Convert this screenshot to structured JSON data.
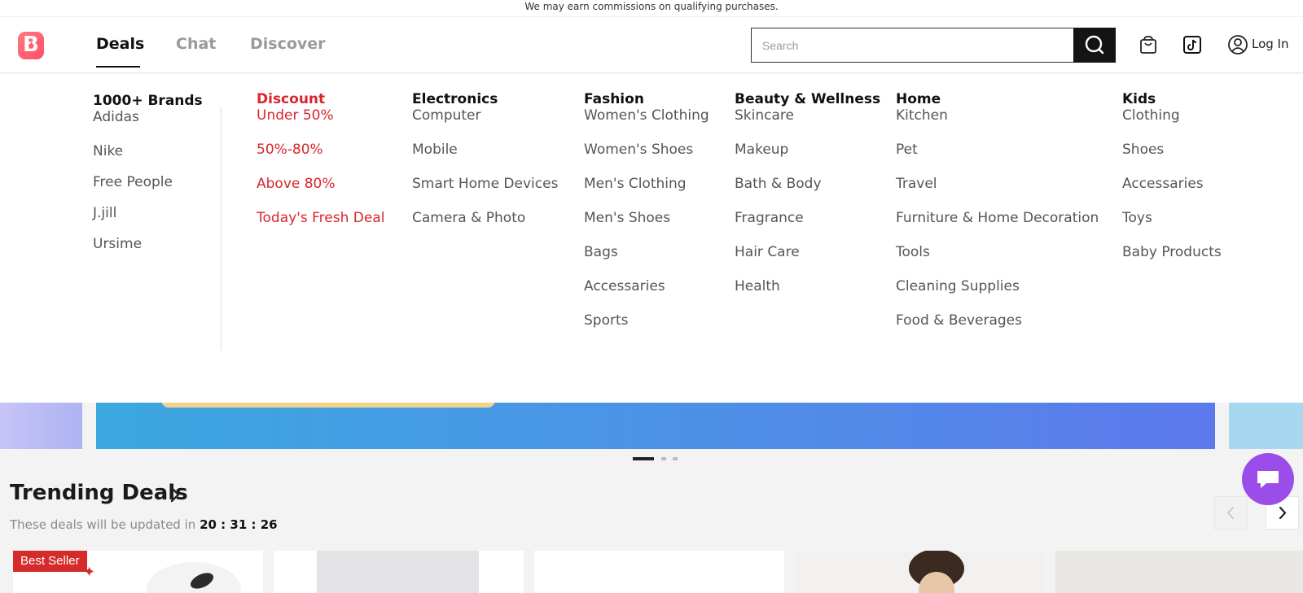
{
  "disclaimer": "We may earn commissions on qualifying purchases.",
  "nav": {
    "tabs": [
      "Deals",
      "Chat",
      "Discover"
    ],
    "active_tab": "Deals"
  },
  "search": {
    "placeholder": "Search"
  },
  "header_actions": {
    "cart_icon": "shopping-bag-icon",
    "tiktok_icon": "tiktok-icon",
    "user_icon": "user-circle-icon",
    "login_label": "Log In"
  },
  "menu": {
    "brands": {
      "title": "1000+ Brands",
      "items": [
        "Adidas",
        "Nike",
        "Free People",
        "J.jill",
        "Ursime"
      ]
    },
    "discount": {
      "title": "Discount",
      "items": [
        "Under 50%",
        "50%-80%",
        "Above 80%",
        "Today's Fresh Deal"
      ]
    },
    "electronics": {
      "title": "Electronics",
      "items": [
        "Computer",
        "Mobile",
        "Smart Home Devices",
        "Camera & Photo"
      ]
    },
    "fashion": {
      "title": "Fashion",
      "items": [
        "Women's Clothing",
        "Women's Shoes",
        "Men's Clothing",
        "Men's Shoes",
        "Bags",
        "Accessaries",
        "Sports"
      ]
    },
    "beauty": {
      "title": "Beauty & Wellness",
      "items": [
        "Skincare",
        "Makeup",
        "Bath & Body",
        "Fragrance",
        "Hair Care",
        "Health"
      ]
    },
    "home": {
      "title": "Home",
      "items": [
        "Kitchen",
        "Pet",
        "Travel",
        "Furniture & Home Decoration",
        "Tools",
        "Cleaning Supplies",
        "Food & Beverages"
      ]
    },
    "kids": {
      "title": "Kids",
      "items": [
        "Clothing",
        "Shoes",
        "Accessaries",
        "Toys",
        "Baby Products"
      ]
    }
  },
  "carousel": {
    "slides": 3,
    "active": 1
  },
  "trending": {
    "title": "Trending Deals",
    "subtitle": "These deals will be updated in",
    "timer": "20 : 31 : 26"
  },
  "cards": [
    {
      "badge": "Best Seller"
    }
  ],
  "colors": {
    "accent_red": "#d9262c",
    "chat_fab": "#9b4dea",
    "logo": "#ff5a6b"
  }
}
